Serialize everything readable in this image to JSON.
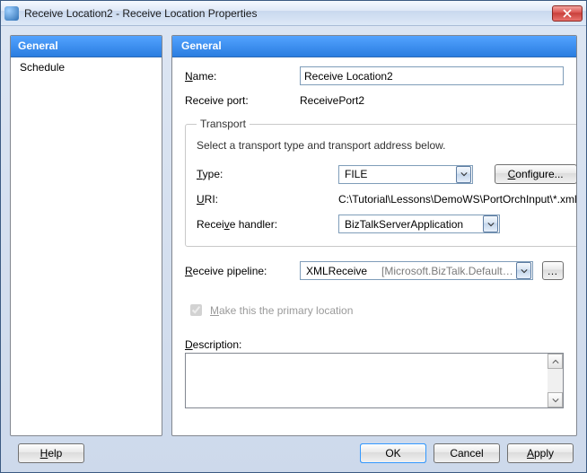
{
  "window": {
    "title": "Receive Location2 - Receive Location Properties"
  },
  "sidebar": {
    "header": "General",
    "items": [
      {
        "label": "Schedule"
      }
    ]
  },
  "content": {
    "header": "General",
    "name_label": "Name:",
    "name_value": "Receive Location2",
    "port_label": "Receive port:",
    "port_value": "ReceivePort2",
    "transport": {
      "legend": "Transport",
      "hint": "Select a transport type and transport address below.",
      "type_label": "Type:",
      "type_value": "FILE",
      "configure_label": "Configure...",
      "uri_label": "URI:",
      "uri_value": "C:\\Tutorial\\Lessons\\DemoWS\\PortOrchInput\\*.xml",
      "handler_label": "Receive handler:",
      "handler_value": "BizTalkServerApplication"
    },
    "pipeline_label": "Receive pipeline:",
    "pipeline_value": "XMLReceive",
    "pipeline_sub": "[Microsoft.BizTalk.DefaultPip",
    "primary_label": "Make this the primary location",
    "description_label": "Description:",
    "description_value": ""
  },
  "footer": {
    "help": "Help",
    "ok": "OK",
    "cancel": "Cancel",
    "apply": "Apply"
  }
}
